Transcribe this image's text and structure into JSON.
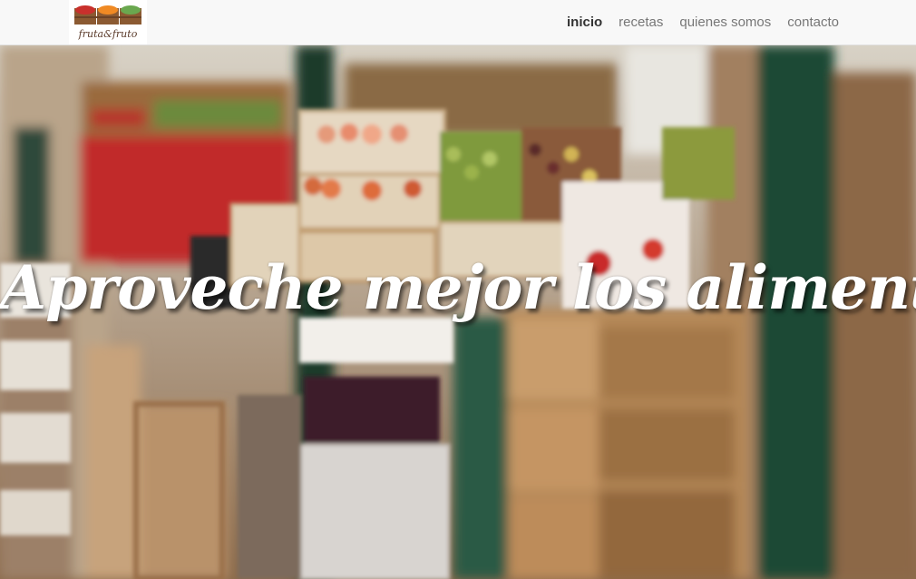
{
  "brand": {
    "logo_text": "fruta&fruto",
    "logo_icon": "fruit-crates-logo"
  },
  "nav": {
    "items": [
      {
        "label": "inicio",
        "active": true
      },
      {
        "label": "recetas",
        "active": false
      },
      {
        "label": "quienes somos",
        "active": false
      },
      {
        "label": "contacto",
        "active": false
      }
    ]
  },
  "hero": {
    "headline": "Aproveche mejor los alimentos",
    "image": "market-fruit-stall-photo"
  },
  "colors": {
    "navbar_bg": "#f8f8f8",
    "nav_active": "#333333",
    "nav_text": "#777777",
    "headline": "#ffffff"
  }
}
